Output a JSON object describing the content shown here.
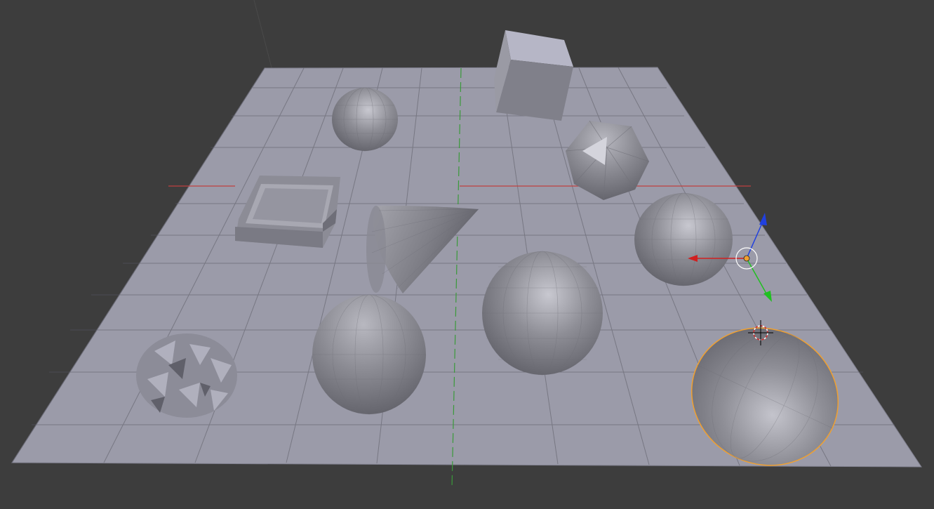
{
  "app": {
    "name": "3D Viewport"
  },
  "viewport": {
    "background": "#3d3d3d",
    "ground_color": "#9a9aa8",
    "grid_line_color": "#505058",
    "axis_x_color": "#c04040",
    "axis_y_color": "#3a9a3a",
    "selection_color": "#f0a030",
    "mesh_color": "#8a8a90"
  },
  "scene": {
    "objects": [
      {
        "name": "uv-sphere-small",
        "kind": "sphere",
        "selected": false
      },
      {
        "name": "cube",
        "kind": "cube",
        "selected": false
      },
      {
        "name": "icosphere",
        "kind": "icosphere",
        "selected": false
      },
      {
        "name": "hollow-box",
        "kind": "box",
        "selected": false
      },
      {
        "name": "cone",
        "kind": "cone",
        "selected": false
      },
      {
        "name": "sphere-right",
        "kind": "sphere",
        "selected": false
      },
      {
        "name": "sphere-center-large",
        "kind": "sphere",
        "selected": false
      },
      {
        "name": "sphere-left-large",
        "kind": "sphere",
        "selected": false
      },
      {
        "name": "noisy-mesh",
        "kind": "displaced-mesh",
        "selected": false
      },
      {
        "name": "ellipsoid",
        "kind": "sphere",
        "selected": true
      }
    ]
  },
  "gizmo": {
    "axes": [
      "x",
      "y",
      "z"
    ],
    "colors": {
      "x": "#d02020",
      "y": "#20c020",
      "z": "#2040e0"
    }
  }
}
